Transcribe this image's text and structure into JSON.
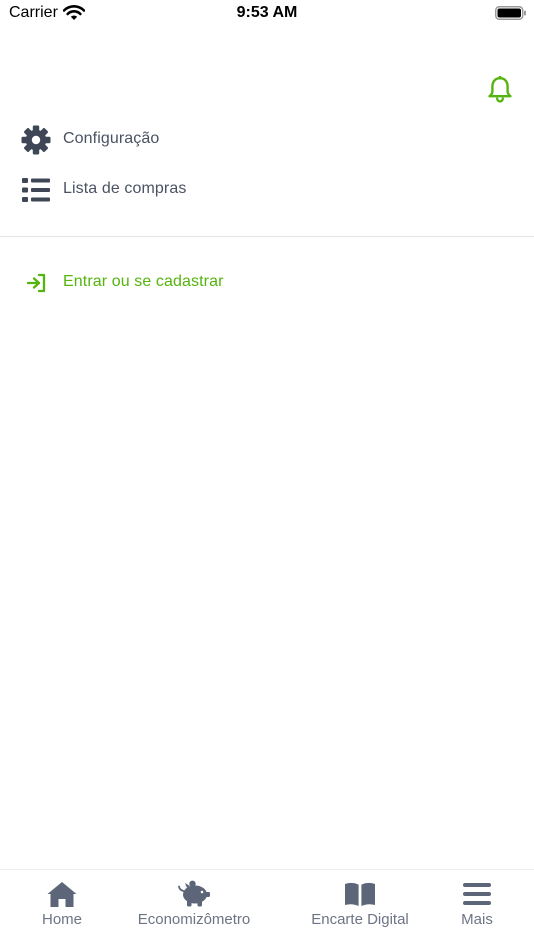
{
  "status_bar": {
    "carrier": "Carrier",
    "time": "9:53 AM"
  },
  "header": {
    "notification_icon": "bell-icon"
  },
  "menu": {
    "items": [
      {
        "label": "Configuração",
        "icon": "gear-icon"
      },
      {
        "label": "Lista de compras",
        "icon": "list-icon"
      }
    ],
    "login": {
      "label": "Entrar ou se cadastrar",
      "icon": "sign-in-icon"
    }
  },
  "tab_bar": {
    "tabs": [
      {
        "label": "Home",
        "icon": "home-icon"
      },
      {
        "label": "Economizômetro",
        "icon": "piggy-bank-icon"
      },
      {
        "label": "Encarte Digital",
        "icon": "book-icon"
      },
      {
        "label": "Mais",
        "icon": "hamburger-menu-icon"
      }
    ]
  },
  "colors": {
    "accent": "#56b40e",
    "icon": "#3f4656",
    "text": "#4b5262",
    "tab_icon": "#5d6679"
  }
}
